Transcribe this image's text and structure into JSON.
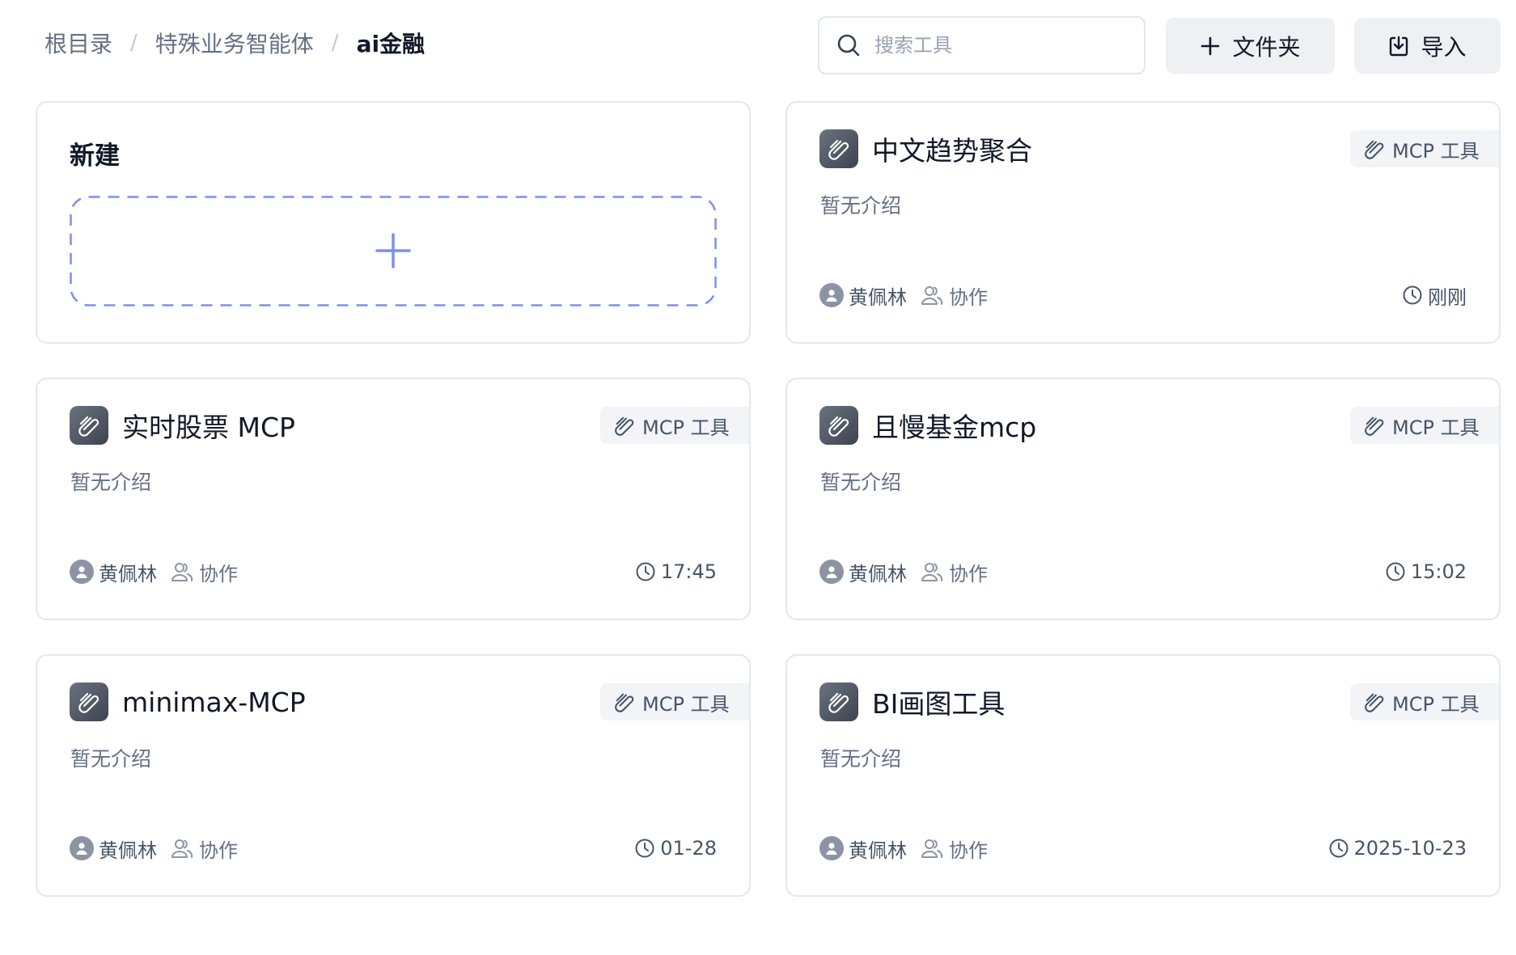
{
  "breadcrumb": {
    "items": [
      "根目录",
      "特殊业务智能体",
      "ai金融"
    ],
    "separator": "/"
  },
  "search": {
    "placeholder": "搜索工具",
    "value": ""
  },
  "toolbar": {
    "folder_label": "文件夹",
    "import_label": "导入"
  },
  "new_card": {
    "title": "新建"
  },
  "colors": {
    "accent": "#7b8ff0",
    "icon_bg": "#4b5160",
    "border": "#e4e7ec"
  },
  "tools": [
    {
      "name": "中文趋势聚合",
      "badge": "MCP 工具",
      "desc": "暂无介绍",
      "owner": "黄佩林",
      "collab": "协作",
      "time": "刚刚",
      "icon": "paperclip-icon"
    },
    {
      "name": "实时股票 MCP",
      "badge": "MCP 工具",
      "desc": "暂无介绍",
      "owner": "黄佩林",
      "collab": "协作",
      "time": "17:45",
      "icon": "paperclip-icon"
    },
    {
      "name": "且慢基金mcp",
      "badge": "MCP 工具",
      "desc": "暂无介绍",
      "owner": "黄佩林",
      "collab": "协作",
      "time": "15:02",
      "icon": "paperclip-icon"
    },
    {
      "name": "minimax-MCP",
      "badge": "MCP 工具",
      "desc": "暂无介绍",
      "owner": "黄佩林",
      "collab": "协作",
      "time": "01-28",
      "icon": "paperclip-icon"
    },
    {
      "name": "BI画图工具",
      "badge": "MCP 工具",
      "desc": "暂无介绍",
      "owner": "黄佩林",
      "collab": "协作",
      "time": "2025-10-23",
      "icon": "paperclip-icon"
    }
  ]
}
